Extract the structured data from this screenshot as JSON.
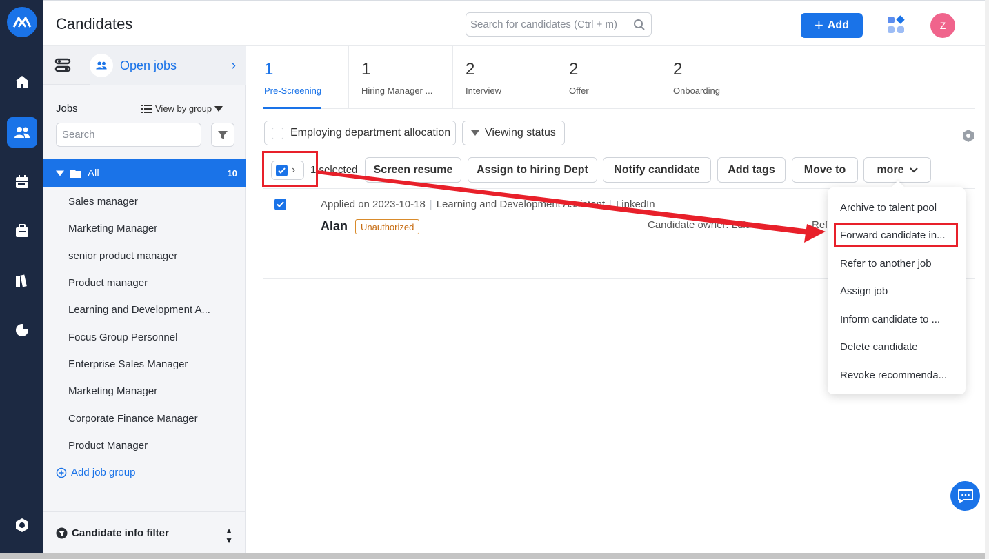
{
  "header": {
    "title": "Candidates",
    "search_placeholder": "Search for candidates (Ctrl + m)",
    "add_label": "Add",
    "avatar_initial": "Z"
  },
  "sidebar": {
    "open_jobs_label": "Open jobs",
    "jobs_label": "Jobs",
    "view_by_group_label": "View by group",
    "search_placeholder": "Search",
    "all_label": "All",
    "all_count": "10",
    "jobs": [
      "Sales manager",
      "Marketing Manager",
      "senior product manager",
      "Product manager",
      "Learning and Development A...",
      "Focus Group Personnel",
      "Enterprise Sales Manager",
      "Marketing Manager",
      "Corporate Finance Manager",
      "Product Manager"
    ],
    "add_job_group_label": "Add job group",
    "candidate_info_filter_label": "Candidate info filter"
  },
  "stages": [
    {
      "count": "1",
      "name": "Pre-Screening"
    },
    {
      "count": "1",
      "name": "Hiring Manager ..."
    },
    {
      "count": "2",
      "name": "Interview"
    },
    {
      "count": "2",
      "name": "Offer"
    },
    {
      "count": "2",
      "name": "Onboarding"
    }
  ],
  "filters": {
    "employing_department": "Employing department allocation",
    "viewing_status": "Viewing status"
  },
  "bulk_actions": {
    "selected_text": "1 selected",
    "screen_resume": "Screen resume",
    "assign_to_hiring_dept": "Assign to hiring Dept",
    "notify_candidate": "Notify candidate",
    "add_tags": "Add tags",
    "move_to": "Move to",
    "more": "more"
  },
  "candidate": {
    "applied_on": "Applied on 2023-10-18",
    "job": "Learning and Development Assistant",
    "source": "LinkedIn",
    "name": "Alan",
    "status_badge": "Unauthorized",
    "owner": "Candidate owner: Lulu",
    "ref": "Ref"
  },
  "more_menu": [
    "Archive to talent pool",
    "Forward candidate in...",
    "Refer to another job",
    "Assign job",
    "Inform candidate to ...",
    "Delete candidate",
    "Revoke recommenda..."
  ],
  "colors": {
    "accent": "#1a73e8",
    "rail": "#1c2942",
    "annotation": "#e8202a",
    "badge": "#c66b10"
  }
}
